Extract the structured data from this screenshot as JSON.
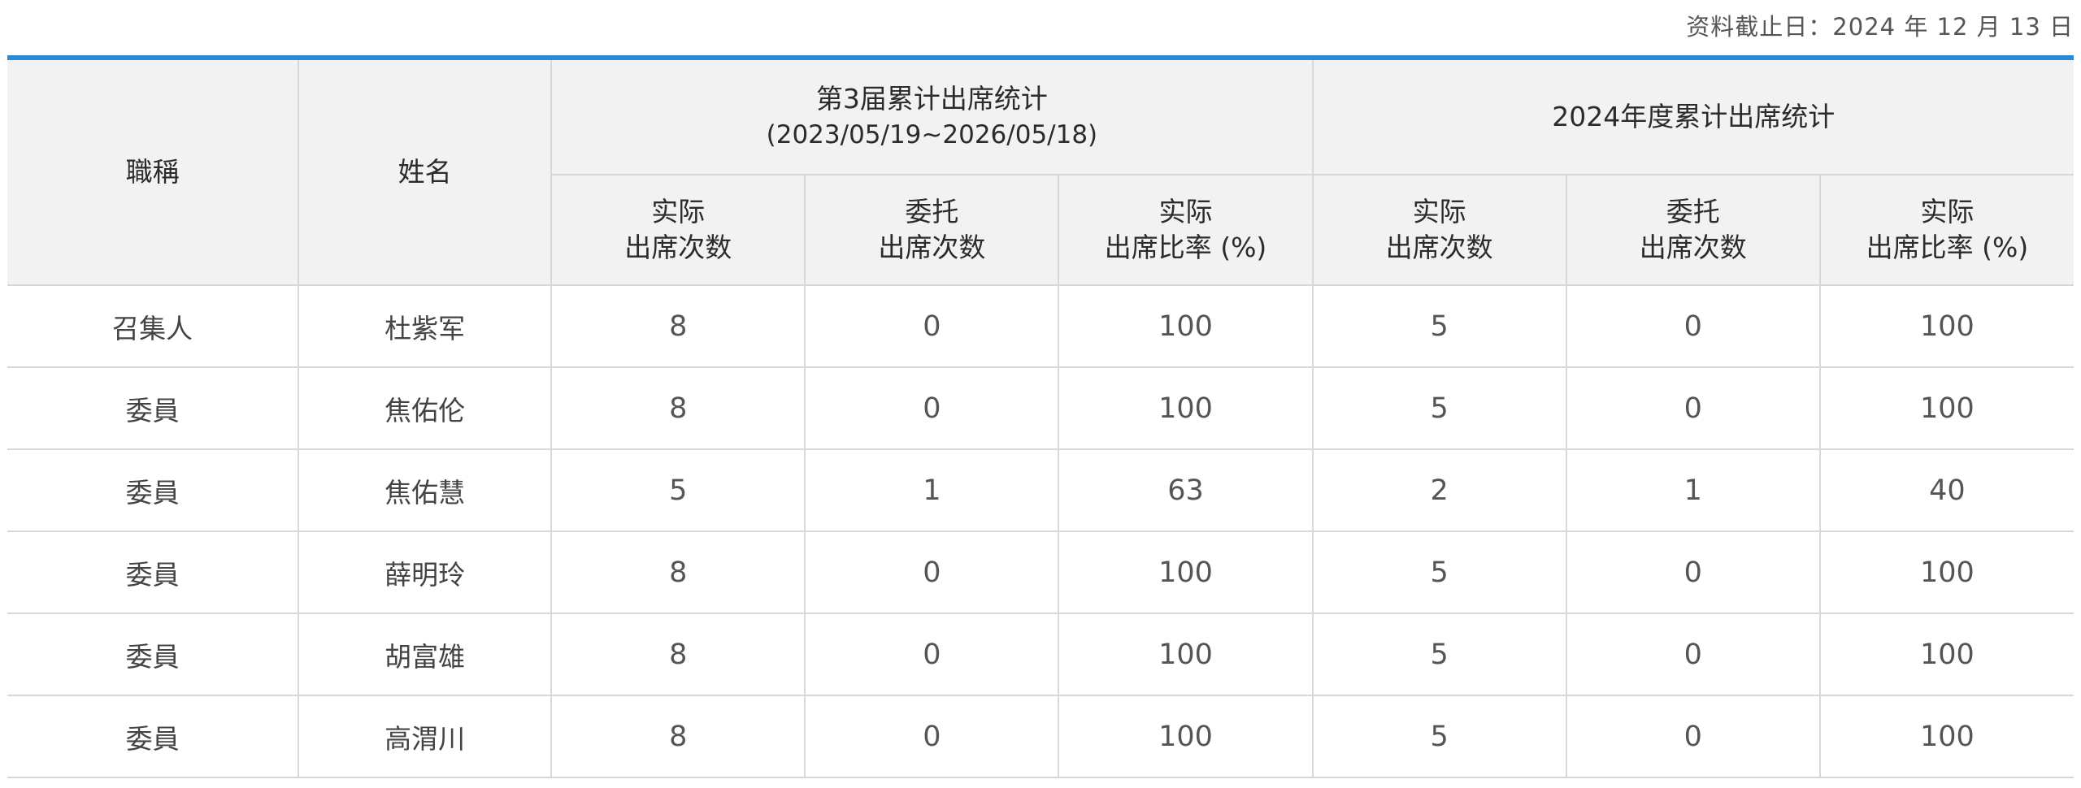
{
  "as_of": "资料截止日：2024 年 12 月 13 日",
  "header": {
    "title_col": "職稱",
    "name_col": "姓名",
    "group1": {
      "title": "第3届累计出席统计",
      "subtitle": "(2023/05/19~2026/05/18)"
    },
    "group2": {
      "title": "2024年度累计出席统计"
    },
    "sub_headers": [
      [
        "实际",
        "出席次数"
      ],
      [
        "委托",
        "出席次数"
      ],
      [
        "实际",
        "出席比率 (%)"
      ],
      [
        "实际",
        "出席次数"
      ],
      [
        "委托",
        "出席次数"
      ],
      [
        "实际",
        "出席比率 (%)"
      ]
    ]
  },
  "rows": [
    {
      "title": "召集人",
      "name": "杜紫军",
      "values": [
        "8",
        "0",
        "100",
        "5",
        "0",
        "100"
      ]
    },
    {
      "title": "委員",
      "name": "焦佑伦",
      "values": [
        "8",
        "0",
        "100",
        "5",
        "0",
        "100"
      ]
    },
    {
      "title": "委員",
      "name": "焦佑慧",
      "values": [
        "5",
        "1",
        "63",
        "2",
        "1",
        "40"
      ]
    },
    {
      "title": "委員",
      "name": "薛明玲",
      "values": [
        "8",
        "0",
        "100",
        "5",
        "0",
        "100"
      ]
    },
    {
      "title": "委員",
      "name": "胡富雄",
      "values": [
        "8",
        "0",
        "100",
        "5",
        "0",
        "100"
      ]
    },
    {
      "title": "委員",
      "name": "高渭川",
      "values": [
        "8",
        "0",
        "100",
        "5",
        "0",
        "100"
      ]
    }
  ],
  "colors": {
    "accent": "#2a8ad4",
    "header_bg": "#f2f2f2",
    "border": "#d8d8d8"
  }
}
